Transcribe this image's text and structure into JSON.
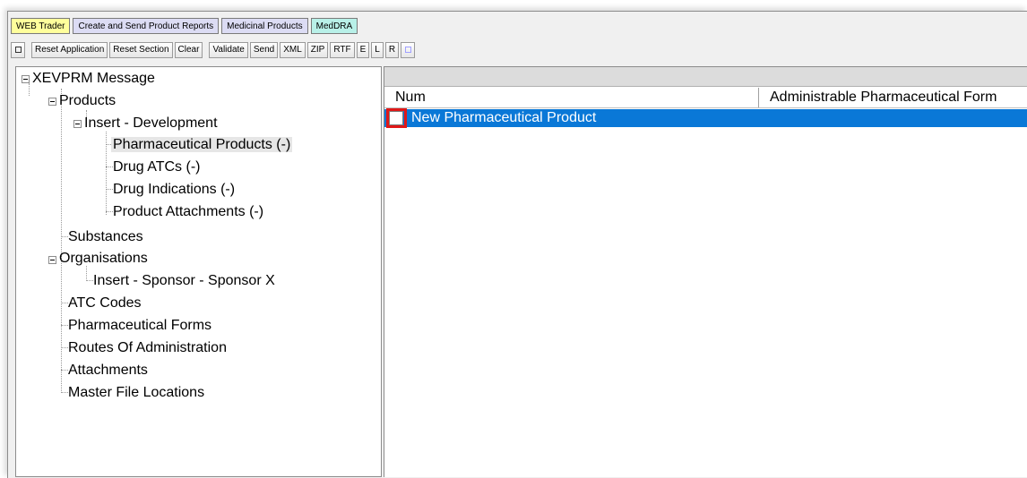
{
  "tabs": [
    {
      "label": "WEB Trader",
      "color": "#ffff9c"
    },
    {
      "label": "Create and Send Product Reports",
      "color": "#dcdcf4"
    },
    {
      "label": "Medicinal Products",
      "color": "#dcdcf4"
    },
    {
      "label": "MedDRA",
      "color": "#b8f0e8"
    }
  ],
  "toolbar": {
    "menu_icon": "square-icon",
    "reset_application": "Reset Application",
    "reset_section": "Reset Section",
    "clear": "Clear",
    "validate": "Validate",
    "send": "Send",
    "xml": "XML",
    "zip": "ZIP",
    "rtf": "RTF",
    "e": "E",
    "l": "L",
    "r": "R",
    "disabled_icon": "square-icon"
  },
  "tree": {
    "root": "XEVPRM Message",
    "products": "Products",
    "insert_development": "Insert - Development",
    "pharmaceutical_products": "Pharmaceutical Products (-)",
    "drug_atcs": "Drug ATCs (-)",
    "drug_indications": "Drug Indications (-)",
    "product_attachments": "Product Attachments (-)",
    "substances": "Substances",
    "organisations": "Organisations",
    "insert_sponsor": "Insert - Sponsor - Sponsor X",
    "atc_codes": "ATC Codes",
    "pharmaceutical_forms": "Pharmaceutical Forms",
    "routes_of_administration": "Routes Of Administration",
    "attachments": "Attachments",
    "master_file_locations": "Master File Locations"
  },
  "grid": {
    "columns": [
      "Num",
      "Administrable Pharmaceutical Form"
    ],
    "rows": [
      {
        "label": "New Pharmaceutical Product",
        "checked": false,
        "selected": true
      }
    ],
    "selection_color": "#0a78d7",
    "highlight_color": "#e01818"
  }
}
